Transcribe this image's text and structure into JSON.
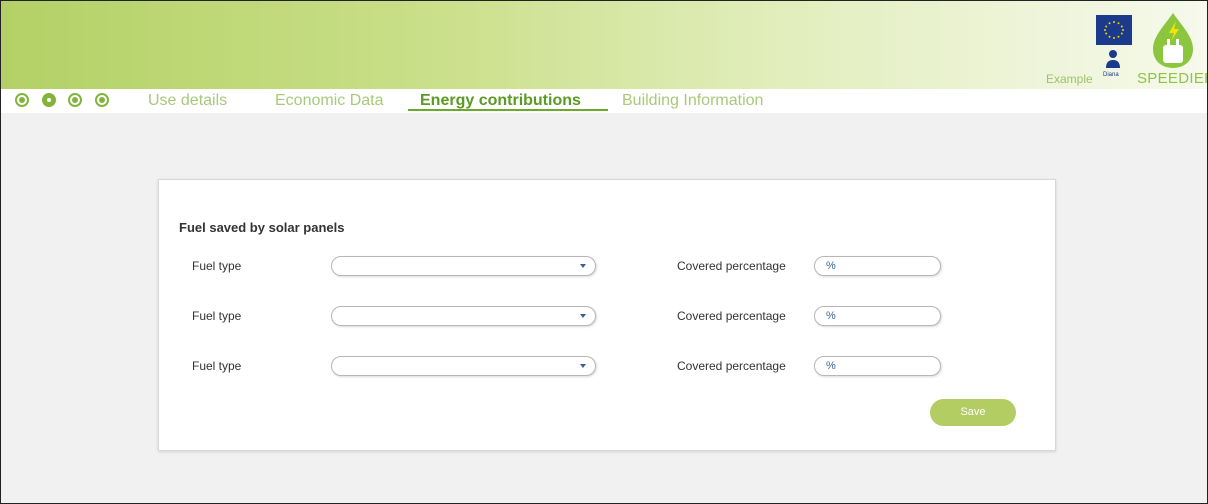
{
  "header": {
    "example_label": "Example",
    "user_name": "Diana",
    "brand": "SPEEDIER"
  },
  "nav": {
    "icons": [
      "home-icon",
      "building-icon",
      "bulb-icon",
      "target-icon"
    ],
    "tabs": [
      {
        "label": "Use details",
        "active": false
      },
      {
        "label": "Economic Data",
        "active": false
      },
      {
        "label": "Energy contributions",
        "active": true
      },
      {
        "label": "Building Information",
        "active": false
      }
    ]
  },
  "form": {
    "title": "Fuel saved by solar panels",
    "rows": [
      {
        "fuel_label": "Fuel type",
        "fuel_value": "",
        "covered_label": "Covered percentage",
        "covered_placeholder": "%"
      },
      {
        "fuel_label": "Fuel type",
        "fuel_value": "",
        "covered_label": "Covered percentage",
        "covered_placeholder": "%"
      },
      {
        "fuel_label": "Fuel type",
        "fuel_value": "",
        "covered_label": "Covered percentage",
        "covered_placeholder": "%"
      }
    ],
    "save_label": "Save"
  },
  "colors": {
    "accent": "#82b43a",
    "active_tab": "#5a9a25",
    "inactive_tab": "#a8c97b",
    "save_button": "#b3cd63"
  }
}
